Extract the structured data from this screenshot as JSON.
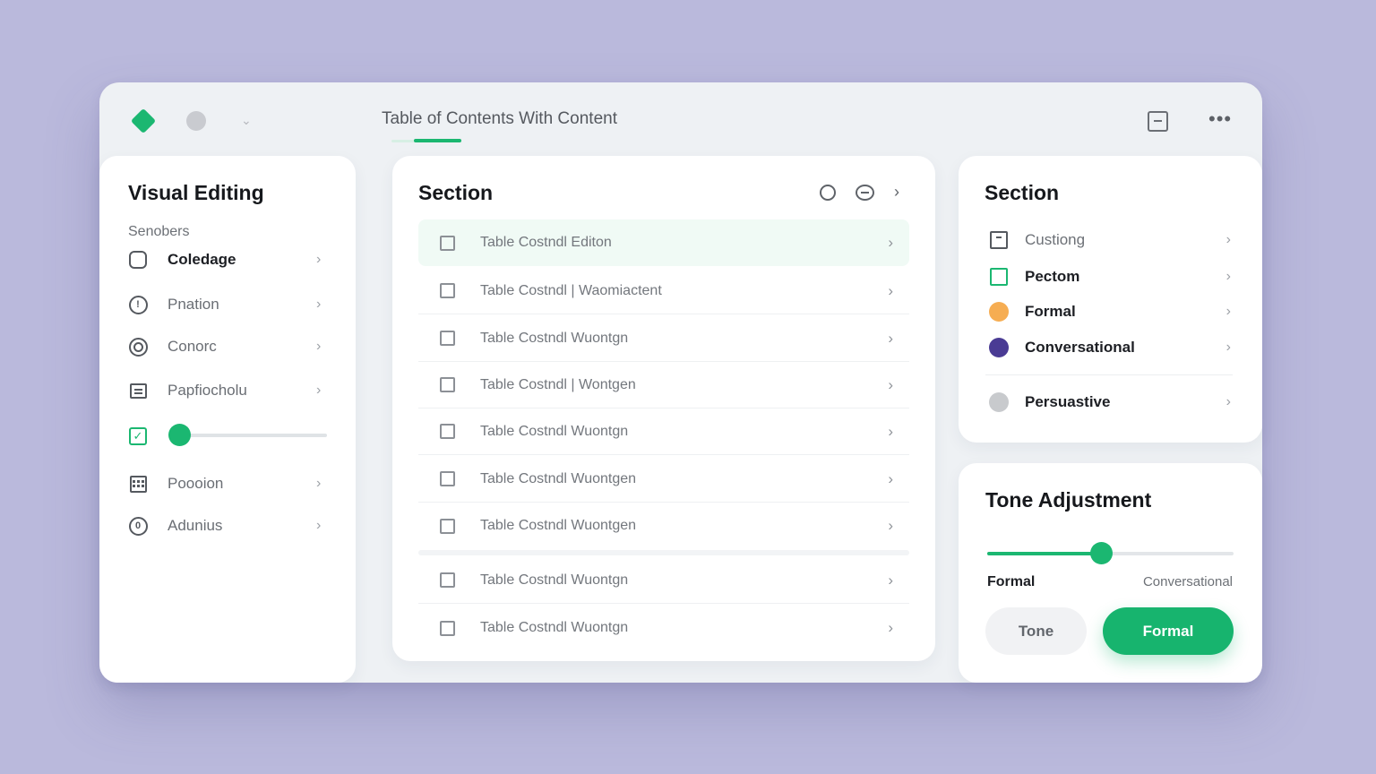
{
  "window": {
    "title": "Table of Contents With Content",
    "more_label": "•••"
  },
  "left_panel": {
    "title": "Visual Editing",
    "subtitle": "Senobers",
    "items": [
      {
        "label": "Coledage",
        "icon": "rounded-square-icon",
        "strong": true
      },
      {
        "label": "Pnation",
        "icon": "info-circle-icon"
      },
      {
        "label": "Conorc",
        "icon": "target-icon"
      },
      {
        "label": "Papfiocholu",
        "icon": "document-icon"
      },
      {
        "label": "Poooion",
        "icon": "grid-icon"
      },
      {
        "label": "Adunius",
        "icon": "zero-circle-icon"
      }
    ],
    "slider": {
      "icon": "checkbox-checked-icon",
      "value": 0.0
    }
  },
  "middle_panel": {
    "title": "Section",
    "rows": [
      {
        "label": "Table Costndl Editon",
        "active": true
      },
      {
        "label": "Table Costndl | Waomiactent"
      },
      {
        "label": "Table Costndl Wuontgn"
      },
      {
        "label": "Table Costndl | Wontgen"
      },
      {
        "label": "Table Costndl Wuontgn"
      },
      {
        "label": "Table Costndl Wuontgen"
      },
      {
        "label": "Table Costndl Wuontgen"
      },
      {
        "label": "Table Costndl Wuontgn"
      },
      {
        "label": "Table Costndl Wuontgn"
      }
    ]
  },
  "right_panel": {
    "title": "Section",
    "items": [
      {
        "label": "Custiong",
        "icon": "outline-square-icon",
        "strong": false
      },
      {
        "label": "Pectom",
        "icon": "green-square-icon",
        "strong": true
      },
      {
        "label": "Formal",
        "icon": "orange-dot-icon",
        "color": "#f6ad52",
        "strong": true
      },
      {
        "label": "Conversational",
        "icon": "purple-dot-icon",
        "color": "#4a3b94",
        "strong": true
      },
      {
        "label": "Persuastive",
        "icon": "grey-dot-icon",
        "color": "#c8cacd",
        "strong": true
      }
    ]
  },
  "tone_panel": {
    "title": "Tone Adjustment",
    "slider_value": 0.46,
    "left_label": "Formal",
    "right_label": "Conversational",
    "button_tone": "Tone",
    "button_formal": "Formal"
  },
  "colors": {
    "accent": "#1bb771",
    "background": "#bab9dc"
  }
}
